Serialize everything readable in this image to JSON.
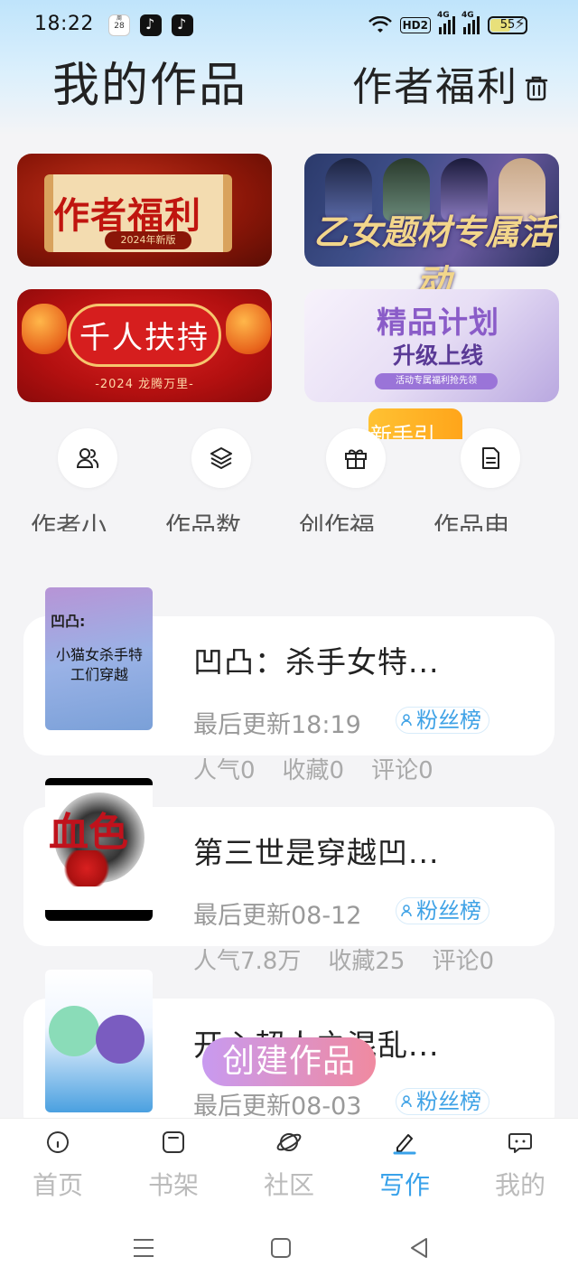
{
  "status_bar": {
    "time": "18:22",
    "calendar_day": "28",
    "network_hd": "HD2",
    "signal1": "4G",
    "signal2": "4G",
    "battery": "55"
  },
  "header": {
    "title": "我的作品",
    "right_title": "作者福利"
  },
  "banners": [
    {
      "title": "作者福利",
      "subtitle": "2024年新版"
    },
    {
      "title": "乙女题材专属活动"
    },
    {
      "title": "千人扶持",
      "subtitle": "-2024 龙腾万里-"
    },
    {
      "title": "精品计划",
      "subtitle": "升级上线",
      "badge": "活动专属福利抢先领"
    }
  ],
  "new_user_tag": "新手引",
  "quick_actions": [
    {
      "label": "作者小",
      "icon": "users-icon"
    },
    {
      "label": "作品数",
      "icon": "layers-icon"
    },
    {
      "label": "创作福",
      "icon": "gift-icon"
    },
    {
      "label": "作品申",
      "icon": "document-icon"
    }
  ],
  "works": [
    {
      "title": "凹凸：杀手女特...",
      "last_update": "最后更新18:19",
      "fans_label": "粉丝榜",
      "stats": {
        "popularity": "人气0",
        "favorites": "收藏0",
        "comments": "评论0"
      },
      "cover_label": "凹凸:",
      "cover_text": "小猫女杀手特工们穿越"
    },
    {
      "title": "第三世是穿越凹...",
      "last_update": "最后更新08-12",
      "fans_label": "粉丝榜",
      "stats": {
        "popularity": "人气7.8万",
        "favorites": "收藏25",
        "comments": "评论0"
      },
      "cover_text": "血色"
    },
    {
      "title": "开心超人之混乱...",
      "last_update": "最后更新08-03",
      "fans_label": "粉丝榜"
    }
  ],
  "create_button": "创建作品",
  "bottom_nav": [
    {
      "label": "首页",
      "icon": "home-icon"
    },
    {
      "label": "书架",
      "icon": "bookshelf-icon"
    },
    {
      "label": "社区",
      "icon": "planet-icon"
    },
    {
      "label": "写作",
      "icon": "pen-icon",
      "active": true
    },
    {
      "label": "我的",
      "icon": "chat-icon"
    }
  ],
  "colors": {
    "accent": "#39a2ea",
    "inactive": "#bbbbbb",
    "create_gradient_start": "#c89af0",
    "create_gradient_end": "#f08aa0"
  }
}
